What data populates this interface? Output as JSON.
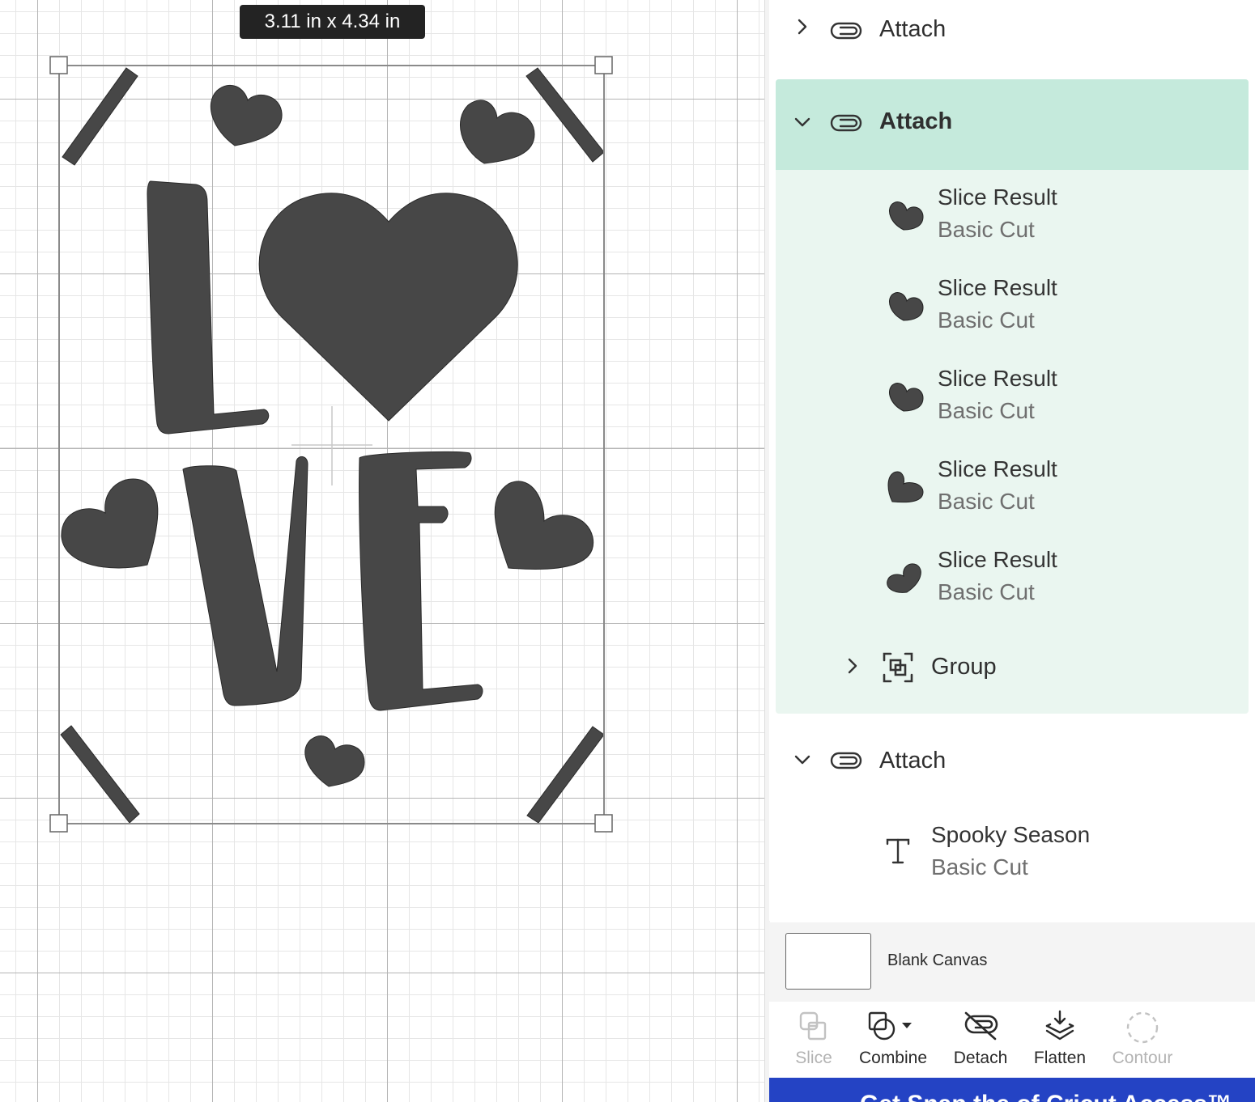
{
  "canvas": {
    "size_label": "3.11  in x 4.34  in"
  },
  "layers": {
    "attach_collapsed": {
      "label": "Attach"
    },
    "attach_selected": {
      "label": "Attach",
      "children": [
        {
          "title": "Slice Result",
          "subtitle": "Basic Cut"
        },
        {
          "title": "Slice Result",
          "subtitle": "Basic Cut"
        },
        {
          "title": "Slice Result",
          "subtitle": "Basic Cut"
        },
        {
          "title": "Slice Result",
          "subtitle": "Basic Cut"
        },
        {
          "title": "Slice Result",
          "subtitle": "Basic Cut"
        }
      ],
      "group_label": "Group"
    },
    "attach_text": {
      "label": "Attach",
      "child": {
        "title": "Spooky Season",
        "subtitle": "Basic Cut"
      }
    },
    "canvas_row": {
      "label": "Blank Canvas"
    }
  },
  "toolbar": {
    "slice": "Slice",
    "combine": "Combine",
    "detach": "Detach",
    "flatten": "Flatten",
    "contour": "Contour"
  },
  "banner": {
    "text": "Get Snap the of Cricut Access™"
  },
  "colors": {
    "shape_fill": "#474747",
    "selected_header": "#c5eadc",
    "selected_group": "#eaf6f0",
    "banner": "#2443c4"
  }
}
